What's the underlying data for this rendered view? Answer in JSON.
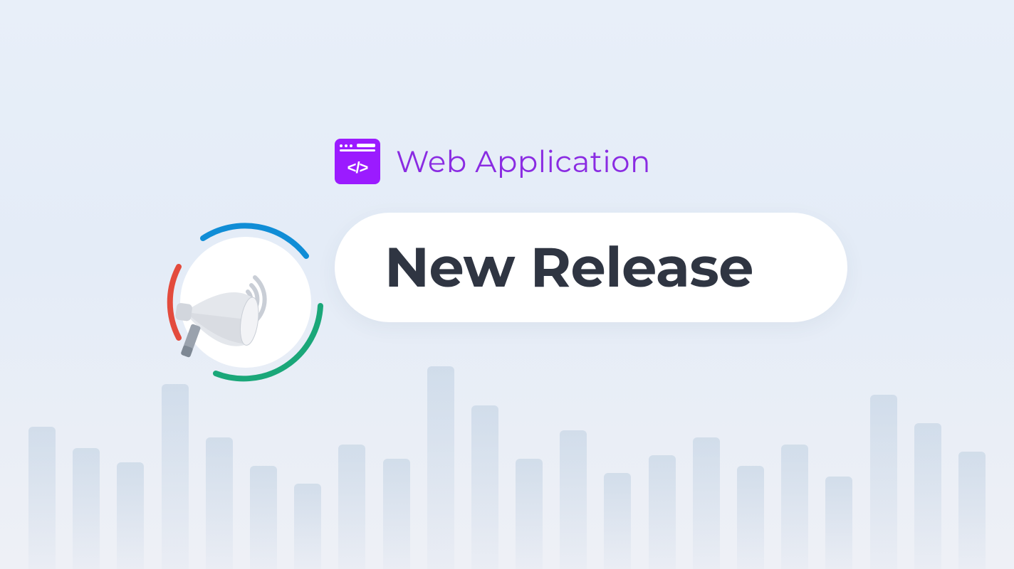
{
  "category": {
    "label": "Web Application",
    "icon_name": "code-window-icon"
  },
  "headline": "New Release",
  "badge": {
    "icon_name": "megaphone-announcement-icon"
  },
  "colors": {
    "accent_purple": "#9b1bff",
    "text_purple": "#8a2be2",
    "headline_text": "#2f3542",
    "ring_blue": "#108dd6",
    "ring_green": "#1aa779",
    "ring_red": "#e34b3d",
    "wave_dot": "#ff6a3d"
  },
  "background_bars_heights": [
    200,
    170,
    150,
    260,
    185,
    145,
    120,
    175,
    155,
    285,
    230,
    155,
    195,
    135,
    160,
    185,
    145,
    175,
    130,
    245,
    205,
    165
  ]
}
